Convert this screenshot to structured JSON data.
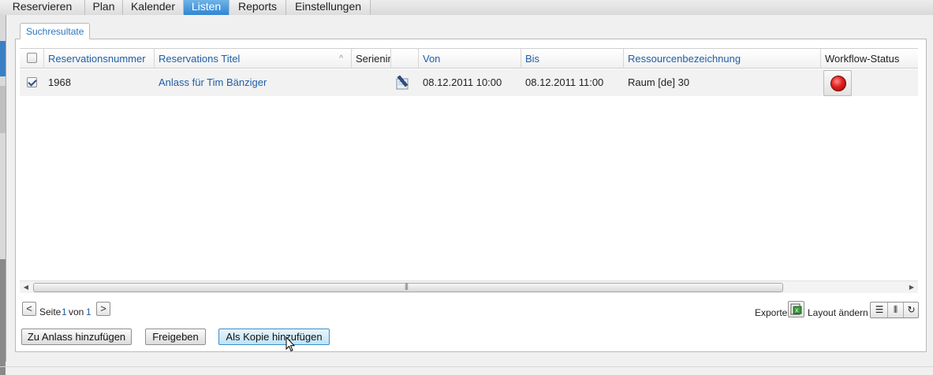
{
  "nav": {
    "tabs": [
      "Reservieren",
      "Plan",
      "Kalender",
      "Listen",
      "Reports",
      "Einstellungen"
    ],
    "active": "Listen"
  },
  "panel": {
    "tab_label": "Suchresultate"
  },
  "grid": {
    "columns": {
      "reservationsnummer": "Reservationsnummer",
      "titel": "Reservations Titel",
      "serie": "Serienin",
      "von": "Von",
      "bis": "Bis",
      "ressource": "Ressourcenbezeichnung",
      "workflow": "Workflow-Status"
    },
    "sort_indicator": "^",
    "rows": [
      {
        "checked": true,
        "reservationsnummer": "1968",
        "titel": "Anlass für Tim Bänziger",
        "von": "08.12.2011 10:00",
        "bis": "08.12.2011 11:00",
        "ressource": "Raum [de] 30",
        "workflow_status": "red"
      }
    ]
  },
  "pager": {
    "seite_label": "Seite",
    "current": "1",
    "von_label": "von",
    "total": "1",
    "prev": "<",
    "next": ">"
  },
  "toolbar": {
    "export_label": "Exporte",
    "layout_label": "Layout ändern"
  },
  "actions": {
    "add_to_event": "Zu Anlass hinzufügen",
    "release": "Freigeben",
    "add_as_copy": "Als Kopie hinzufügen"
  },
  "colors": {
    "accent": "#2f86d2",
    "link": "#1f5fa8",
    "status_red": "#e0201c"
  }
}
